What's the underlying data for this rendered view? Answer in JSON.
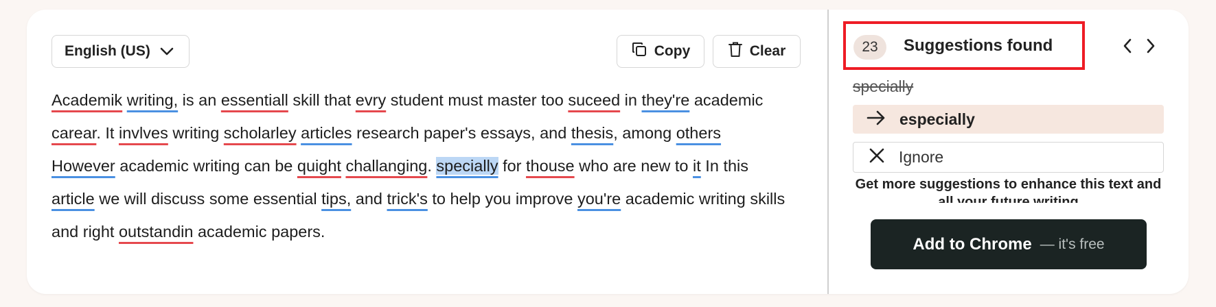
{
  "editor": {
    "language": "English (US)",
    "copy_label": "Copy",
    "clear_label": "Clear",
    "text": {
      "w1": "Academik",
      "t1": " ",
      "w2": "writing,",
      "t2": " is an ",
      "w3": "essentiall",
      "t3": " skill that ",
      "w4": "evry",
      "t4": " student must master too ",
      "w5": "suceed",
      "t5": " in ",
      "w6": "they're",
      "t6": " academic ",
      "w7": "carear",
      "t7": ". It ",
      "w8": "invlves",
      "t8": " writing ",
      "w9": "scholarley",
      "t9": " ",
      "w10": "articles",
      "t10": " research paper's essays, and ",
      "w11": "thesis",
      "t11": ", among ",
      "w12": "others",
      "w13": "However",
      "t13": " academic writing can be ",
      "w14": "quight",
      "t14": " ",
      "w15": "challanging",
      "t15": ". ",
      "w16": "specially",
      "t16": " for ",
      "w17": "thouse",
      "t17": " who are new to ",
      "w18": "it",
      "t18": " In this ",
      "w19": "article",
      "t19": " we will discuss some essential ",
      "w20": "tips,",
      "t20": " and ",
      "w21": "trick's",
      "t21": " to help you improve ",
      "w22": "you're",
      "t22": " academic writing skills",
      "t23": "and right ",
      "w24": "outstandin",
      "t24": " academic papers."
    }
  },
  "panel": {
    "count": "23",
    "title": "Suggestions found",
    "original_word": "specially",
    "replacement": "especially",
    "ignore_label": "Ignore",
    "more_text": "Get more suggestions to enhance this text and all your future writing",
    "cta_main": "Add to Chrome",
    "cta_sub": "— it's free"
  },
  "colors": {
    "spelling_underline": "#e5484d",
    "grammar_underline": "#4a90e2",
    "highlight": "#bcd7f5",
    "cta_bg": "#1b2423",
    "annotation_box": "#ee1c25"
  }
}
